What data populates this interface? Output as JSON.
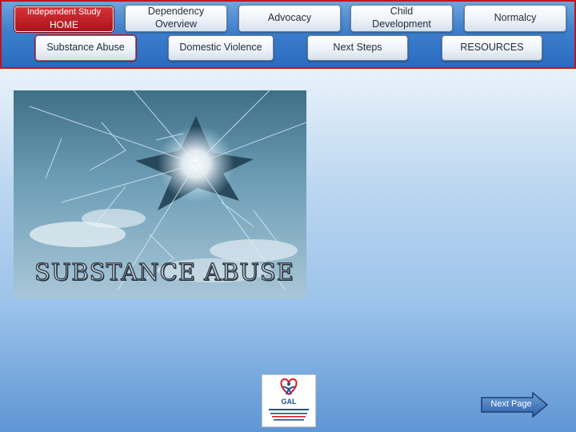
{
  "nav": {
    "home_line1": "Independent Study",
    "home_line2": "HOME",
    "dependency": "Dependency Overview",
    "advocacy": "Advocacy",
    "child_development": "Child Development",
    "normalcy": "Normalcy",
    "substance_abuse": "Substance Abuse",
    "domestic_violence": "Domestic Violence",
    "next_steps": "Next Steps",
    "resources": "RESOURCES"
  },
  "hero": {
    "title": "SUBSTANCE ABUSE",
    "image": "broken-glass-sky-image"
  },
  "logo": {
    "text": "GAL",
    "icon": "gal-logo-icon"
  },
  "next_page": {
    "label": "Next Page",
    "icon": "arrow-right-icon"
  },
  "colors": {
    "nav_bg": "#3d7fcc",
    "nav_border": "#c0151b",
    "home_bg": "#a8141b",
    "page_bg_bottom": "#5f96d4"
  }
}
